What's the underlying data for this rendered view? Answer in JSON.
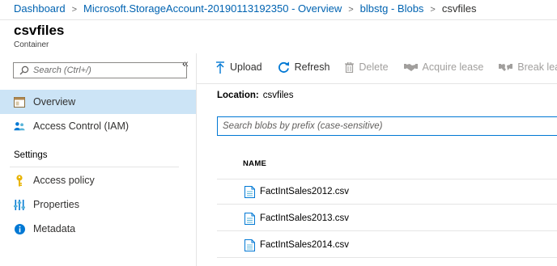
{
  "breadcrumb": {
    "items": [
      "Dashboard",
      "Microsoft.StorageAccount-20190113192350 - Overview",
      "blbstg - Blobs"
    ],
    "current": "csvfiles"
  },
  "blade": {
    "title": "csvfiles",
    "subtitle": "Container"
  },
  "nav": {
    "collapse_glyph": "«",
    "search_placeholder": "Search (Ctrl+/)",
    "items": [
      {
        "label": "Overview",
        "icon": "overview-icon",
        "active": true
      },
      {
        "label": "Access Control (IAM)",
        "icon": "people-icon"
      },
      {
        "label": "Access policy",
        "icon": "key-icon"
      },
      {
        "label": "Properties",
        "icon": "properties-icon"
      },
      {
        "label": "Metadata",
        "icon": "info-icon"
      }
    ],
    "section_settings": "Settings"
  },
  "toolbar": {
    "upload": "Upload",
    "refresh": "Refresh",
    "delete": "Delete",
    "acquire_lease": "Acquire lease",
    "break_lease": "Break lease"
  },
  "location": {
    "label": "Location:",
    "value": "csvfiles"
  },
  "blob_search": {
    "placeholder": "Search blobs by prefix (case-sensitive)"
  },
  "table": {
    "columns": [
      "NAME"
    ],
    "rows": [
      {
        "name": "FactIntSales2012.csv"
      },
      {
        "name": "FactIntSales2013.csv"
      },
      {
        "name": "FactIntSales2014.csv"
      }
    ]
  },
  "colors": {
    "link": "#0063b1",
    "accent": "#0078d4",
    "active_nav": "#cce4f6",
    "disabled": "#a19f9d"
  }
}
